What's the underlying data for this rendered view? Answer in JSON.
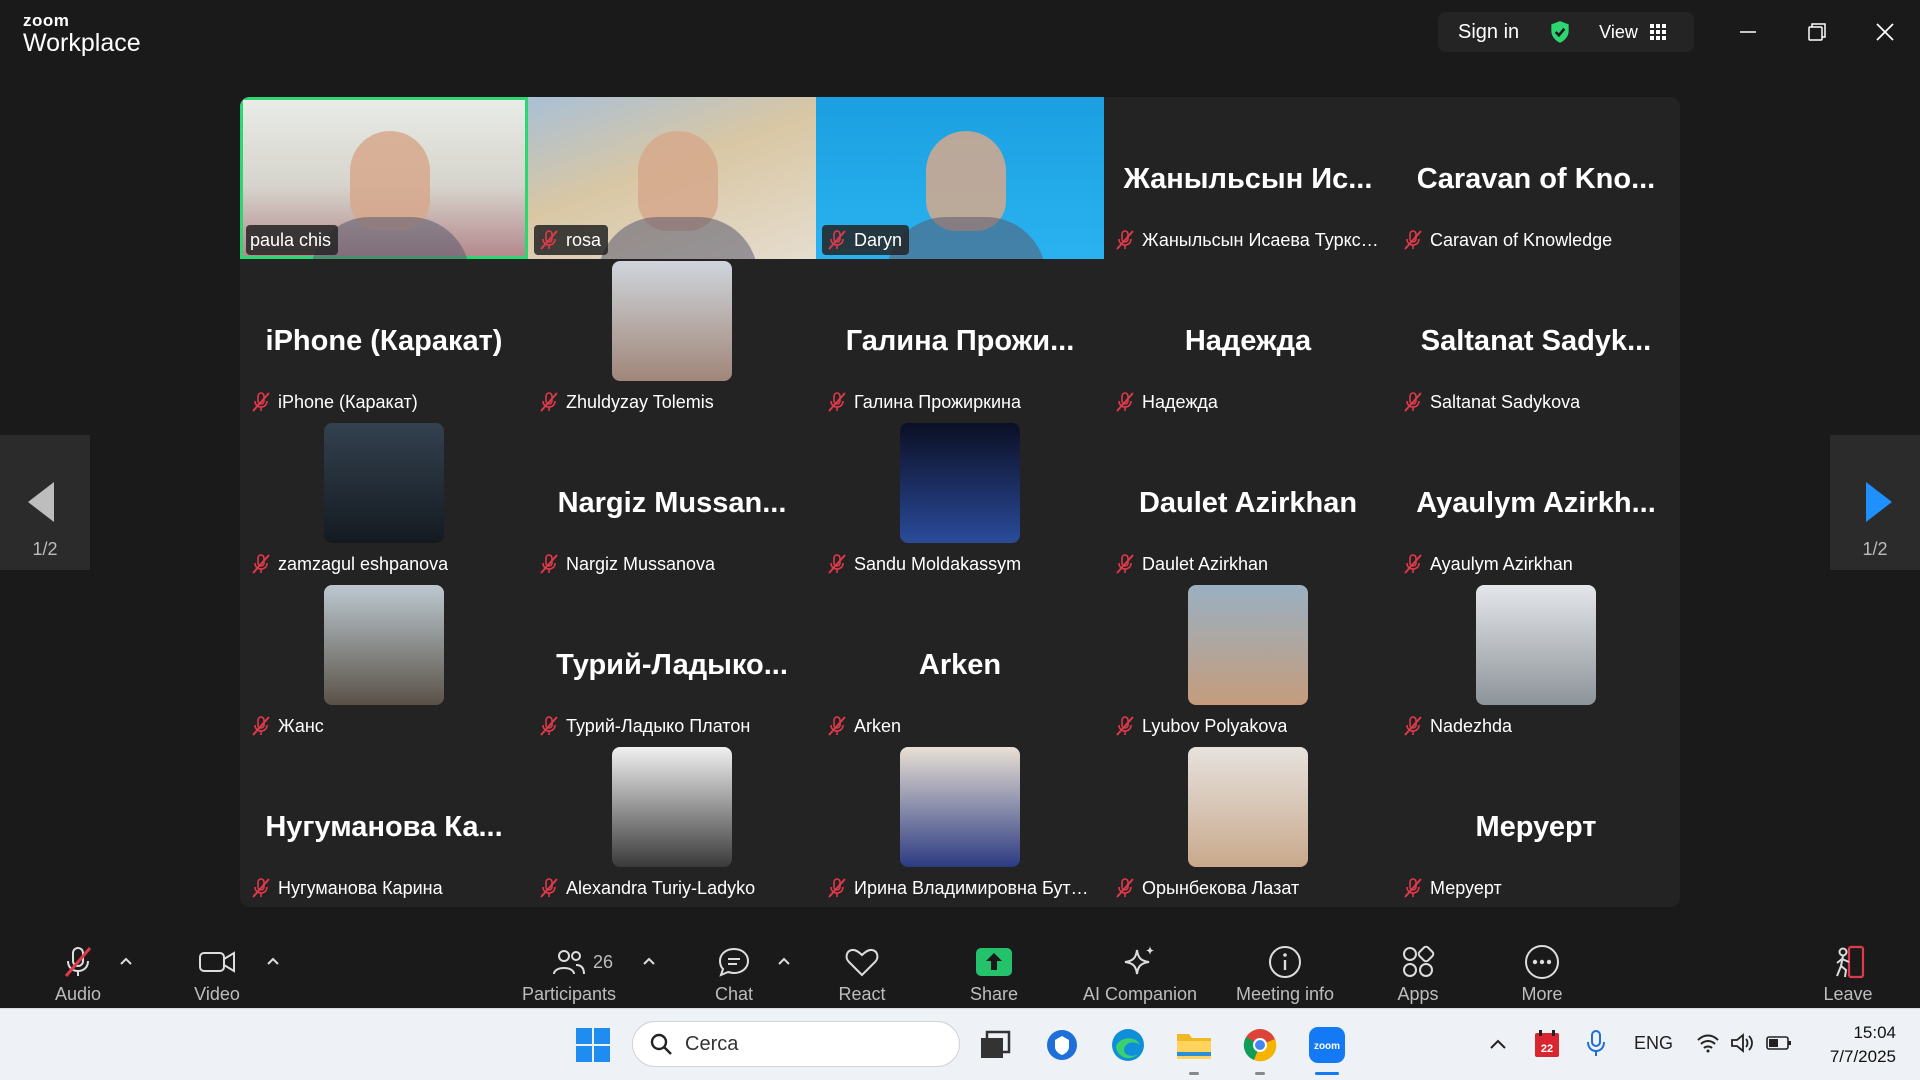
{
  "titlebar": {
    "brand_small": "zoom",
    "brand_large": "Workplace",
    "sign_in": "Sign in",
    "view_label": "View"
  },
  "gallery": {
    "page_left": "1/2",
    "page_right": "1/2",
    "tiles": [
      {
        "name": "paula chis",
        "display": "",
        "kind": "video",
        "active": true
      },
      {
        "name": "rosa",
        "display": "",
        "kind": "video"
      },
      {
        "name": "Daryn",
        "display": "",
        "kind": "video"
      },
      {
        "name": "Жаныльсын Исаева  Туркси...",
        "display": "Жаныльсын  Ис...",
        "kind": "text"
      },
      {
        "name": "Caravan of Knowledge",
        "display": "Caravan  of  Kno...",
        "kind": "text"
      },
      {
        "name": "iPhone (Каракат)",
        "display": "iPhone (Каракат)",
        "kind": "text"
      },
      {
        "name": "Zhuldyzay Tolemis",
        "display": "",
        "kind": "avatar"
      },
      {
        "name": "Галина Прожиркина",
        "display": "Галина  Прожи...",
        "kind": "text"
      },
      {
        "name": "Надежда",
        "display": "Надежда",
        "kind": "text"
      },
      {
        "name": "Saltanat Sadykova",
        "display": "Saltanat  Sadyk...",
        "kind": "text"
      },
      {
        "name": "zamzagul eshpanova",
        "display": "",
        "kind": "avatar"
      },
      {
        "name": "Nargiz Mussanova",
        "display": "Nargiz  Mussan...",
        "kind": "text"
      },
      {
        "name": "Sandu Moldakassym",
        "display": "",
        "kind": "avatar"
      },
      {
        "name": "Daulet Azirkhan",
        "display": "Daulet Azirkhan",
        "kind": "text"
      },
      {
        "name": "Ayaulym Azirkhan",
        "display": "Ayaulym  Azirkh...",
        "kind": "text"
      },
      {
        "name": "Жанс",
        "display": "",
        "kind": "avatar"
      },
      {
        "name": "Турий-Ладыко Платон",
        "display": "Турий-Ладыко...",
        "kind": "text"
      },
      {
        "name": "Arken",
        "display": "Arken",
        "kind": "text"
      },
      {
        "name": "Lyubov Polyakova",
        "display": "",
        "kind": "avatar"
      },
      {
        "name": "Nadezhda",
        "display": "",
        "kind": "avatar"
      },
      {
        "name": "Нугуманова Карина",
        "display": "Нугуманова  Ка...",
        "kind": "text"
      },
      {
        "name": "Alexandra Turiy-Ladyko",
        "display": "",
        "kind": "avatar"
      },
      {
        "name": "Ирина Владимировна Буто...",
        "display": "",
        "kind": "avatar"
      },
      {
        "name": "Орынбекова Лазат",
        "display": "",
        "kind": "avatar"
      },
      {
        "name": "Меруерт",
        "display": "Меруерт",
        "kind": "text"
      }
    ]
  },
  "toolbar": {
    "audio": "Audio",
    "video": "Video",
    "participants": "Participants",
    "participants_count": "26",
    "chat": "Chat",
    "react": "React",
    "share": "Share",
    "ai_companion": "AI Companion",
    "meeting_info": "Meeting info",
    "apps": "Apps",
    "more": "More",
    "leave": "Leave"
  },
  "taskbar": {
    "search_placeholder": "Cerca",
    "language": "ENG",
    "calendar_badge": "22",
    "time": "15:04",
    "date": "7/7/2025"
  },
  "colors": {
    "active_speaker": "#2ed573",
    "share_green": "#23c26b",
    "mute_red": "#e0394a",
    "nav_arrow_blue": "#1e90ff"
  }
}
